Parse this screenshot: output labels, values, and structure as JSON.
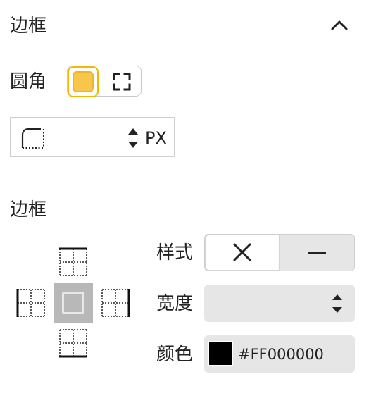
{
  "panel": {
    "title": "边框",
    "collapse_icon": "chevron-up-icon"
  },
  "corner": {
    "label": "圆角",
    "modes": [
      {
        "name": "uniform",
        "icon": "rounded-square-icon",
        "selected": true
      },
      {
        "name": "separate",
        "icon": "corner-brackets-icon",
        "selected": false
      }
    ],
    "accent": "#F8C64B",
    "radius": {
      "value": "",
      "unit": "PX",
      "icon": "corner-radius-icon"
    }
  },
  "border": {
    "title": "边框",
    "sides": [
      {
        "name": "top",
        "icon": "border-top-icon"
      },
      {
        "name": "left",
        "icon": "border-left-icon"
      },
      {
        "name": "all",
        "icon": "border-all-icon",
        "selected": true
      },
      {
        "name": "right",
        "icon": "border-right-icon"
      },
      {
        "name": "bottom",
        "icon": "border-bottom-icon"
      }
    ],
    "style": {
      "label": "样式",
      "options": [
        {
          "name": "none",
          "icon": "x-icon",
          "selected": true
        },
        {
          "name": "solid",
          "icon": "solid-line-icon",
          "selected": false
        }
      ]
    },
    "width": {
      "label": "宽度",
      "value": ""
    },
    "color": {
      "label": "颜色",
      "value": "#FF000000",
      "swatch": "#000000"
    }
  }
}
